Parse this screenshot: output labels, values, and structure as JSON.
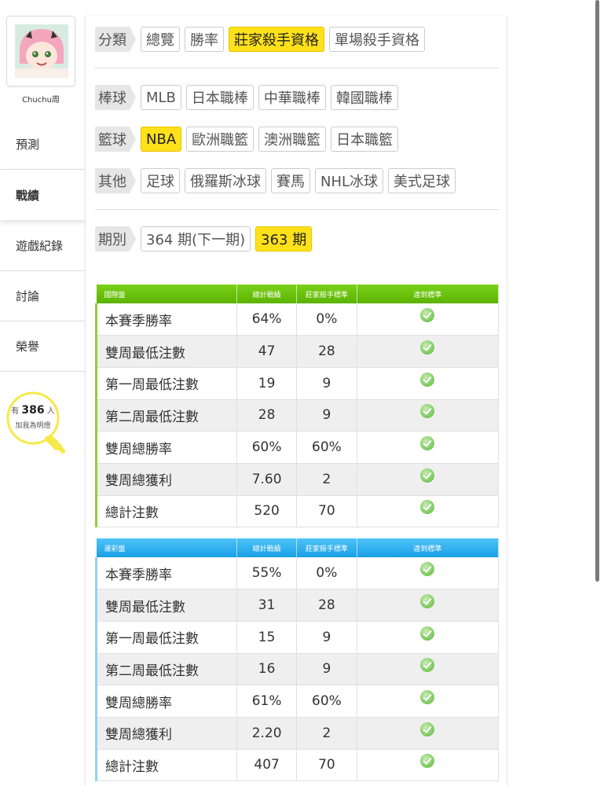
{
  "user": {
    "name": "Chuchu周"
  },
  "sidebar": {
    "items": [
      {
        "label": "預測"
      },
      {
        "label": "戰績"
      },
      {
        "label": "遊戲紀錄"
      },
      {
        "label": "討論"
      },
      {
        "label": "榮譽"
      }
    ],
    "fans": {
      "prefix": "有",
      "count": "386",
      "suffix": "人",
      "caption": "加我為明燈"
    }
  },
  "filters": {
    "category": {
      "label": "分類",
      "options": [
        "總覽",
        "勝率",
        "莊家殺手資格",
        "單場殺手資格"
      ],
      "selected": "莊家殺手資格"
    },
    "baseball": {
      "label": "棒球",
      "options": [
        "MLB",
        "日本職棒",
        "中華職棒",
        "韓國職棒"
      ]
    },
    "basketball": {
      "label": "籃球",
      "options": [
        "NBA",
        "歐洲職籃",
        "澳洲職籃",
        "日本職籃"
      ],
      "selected": "NBA"
    },
    "others": {
      "label": "其他",
      "options": [
        "足球",
        "俄羅斯冰球",
        "賽馬",
        "NHL冰球",
        "美式足球"
      ]
    },
    "period": {
      "label": "期別",
      "options": [
        "364 期(下一期)",
        "363 期"
      ],
      "selected": "363 期"
    }
  },
  "tables": [
    {
      "title": "國際盤",
      "columns": [
        "國際盤",
        "總計戰績",
        "莊家殺手標準",
        "達到標準"
      ],
      "rows": [
        {
          "label": "本賽季勝率",
          "record": "64%",
          "standard": "0%",
          "met": true
        },
        {
          "label": "雙周最低注數",
          "record": "47",
          "standard": "28",
          "met": true
        },
        {
          "label": "第一周最低注數",
          "record": "19",
          "standard": "9",
          "met": true
        },
        {
          "label": "第二周最低注數",
          "record": "28",
          "standard": "9",
          "met": true
        },
        {
          "label": "雙周總勝率",
          "record": "60%",
          "standard": "60%",
          "met": true
        },
        {
          "label": "雙周總獲利",
          "record": "7.60",
          "standard": "2",
          "met": true
        },
        {
          "label": "總計注數",
          "record": "520",
          "standard": "70",
          "met": true
        }
      ]
    },
    {
      "title": "運彩盤",
      "columns": [
        "運彩盤",
        "總計戰績",
        "莊家殺手標準",
        "達到標準"
      ],
      "rows": [
        {
          "label": "本賽季勝率",
          "record": "55%",
          "standard": "0%",
          "met": true
        },
        {
          "label": "雙周最低注數",
          "record": "31",
          "standard": "28",
          "met": true
        },
        {
          "label": "第一周最低注數",
          "record": "15",
          "standard": "9",
          "met": true
        },
        {
          "label": "第二周最低注數",
          "record": "16",
          "standard": "9",
          "met": true
        },
        {
          "label": "雙周總勝率",
          "record": "61%",
          "standard": "60%",
          "met": true
        },
        {
          "label": "雙周總獲利",
          "record": "2.20",
          "standard": "2",
          "met": true
        },
        {
          "label": "總計注數",
          "record": "407",
          "standard": "70",
          "met": true
        }
      ]
    }
  ],
  "colors": {
    "selected": "#ffe11a",
    "green_header": "#5cb300",
    "blue_header": "#1aa0e6"
  }
}
